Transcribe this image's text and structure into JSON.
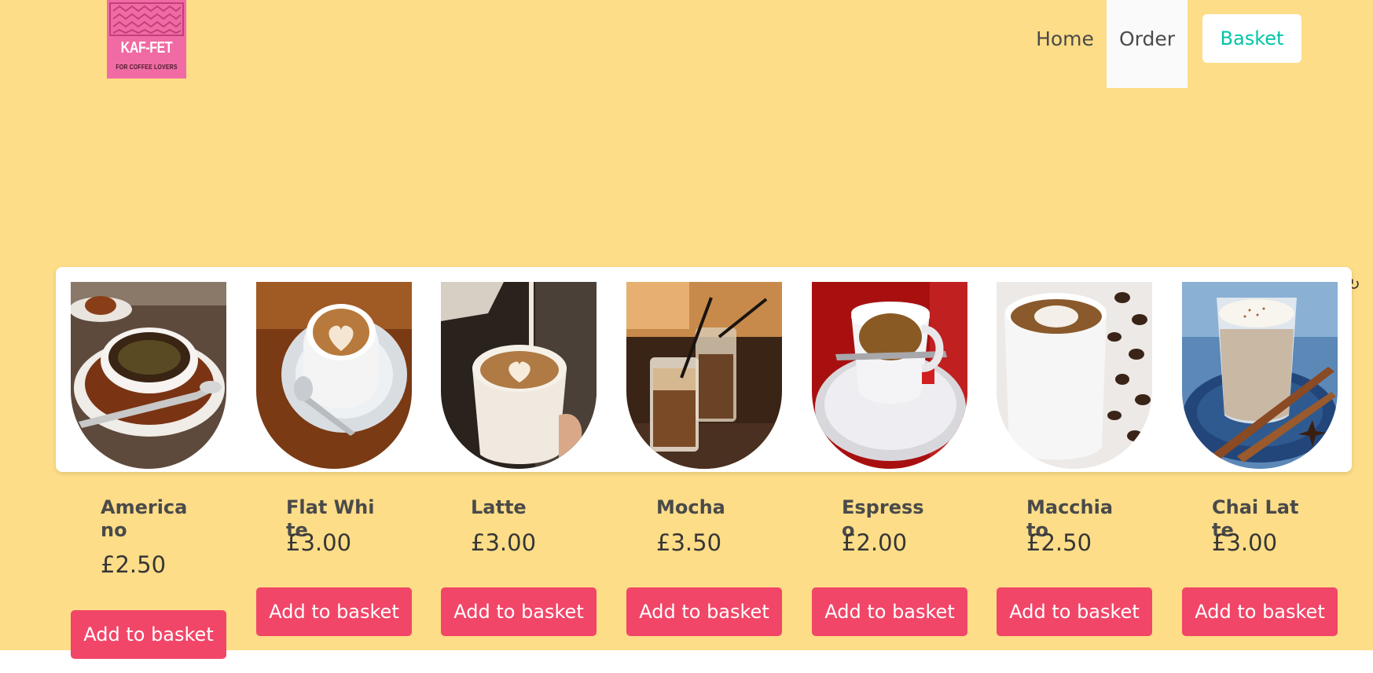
{
  "brand": {
    "name": "KAF-FET",
    "tagline": "FOR COFFEE LOVERS",
    "color": "#f06ba3"
  },
  "nav": {
    "home": "Home",
    "order": "Order",
    "basket": "Basket"
  },
  "colors": {
    "page_background": "#fddd87",
    "button": "#f14668",
    "basket_link": "#00c4a7"
  },
  "products": [
    {
      "name": "Americano",
      "price": "£2.50",
      "button": "Add to basket",
      "image": "americano-photo"
    },
    {
      "name": "Flat White",
      "price": "£3.00",
      "button": "Add to basket",
      "image": "flat-white-photo"
    },
    {
      "name": "Latte",
      "price": "£3.00",
      "button": "Add to basket",
      "image": "latte-photo"
    },
    {
      "name": "Mocha",
      "price": "£3.50",
      "button": "Add to basket",
      "image": "mocha-photo"
    },
    {
      "name": "Espresso",
      "price": "£2.00",
      "button": "Add to basket",
      "image": "espresso-photo"
    },
    {
      "name": "Macchiato",
      "price": "£2.50",
      "button": "Add to basket",
      "image": "macchiato-photo"
    },
    {
      "name": "Chai Latte",
      "price": "£3.00",
      "button": "Add to basket",
      "image": "chai-latte-photo"
    }
  ]
}
